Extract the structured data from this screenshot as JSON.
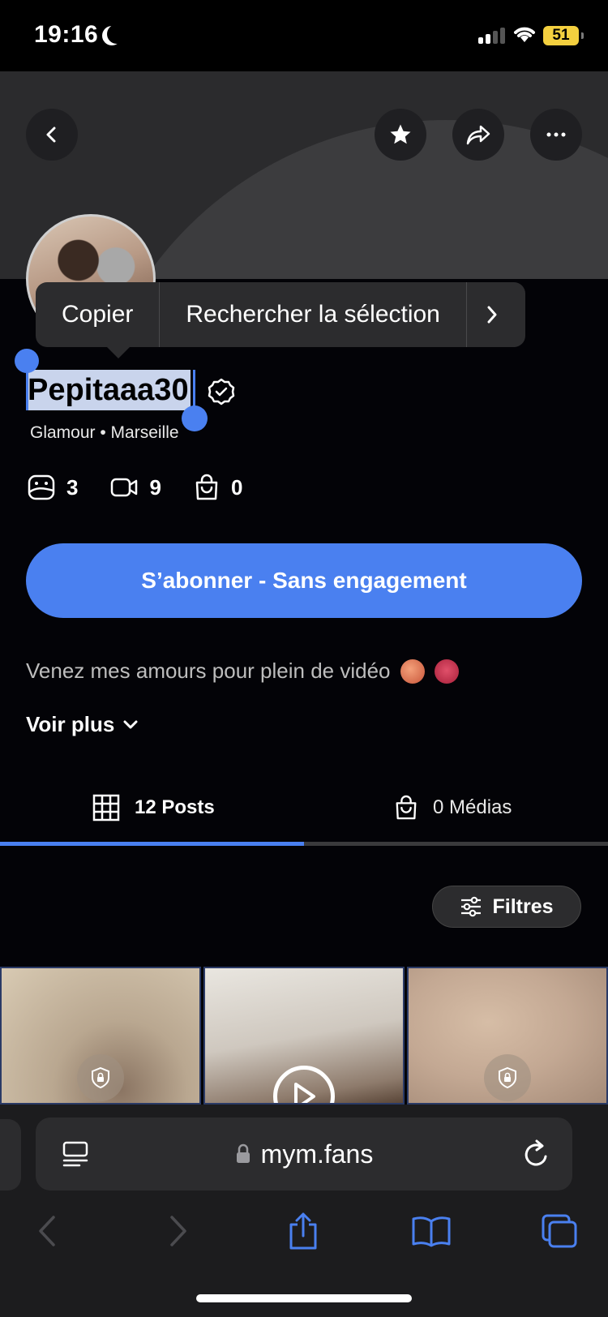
{
  "status": {
    "time": "19:16",
    "battery": "51"
  },
  "profile": {
    "username": "Pepitaaa30",
    "subtitle": "Glamour • Marseille",
    "stats": [
      {
        "icon": "photo-icon",
        "count": "3"
      },
      {
        "icon": "video-icon",
        "count": "9"
      },
      {
        "icon": "shopping-bag-icon",
        "count": "0"
      }
    ],
    "subscribe_label": "S’abonner - Sans engagement",
    "bio": "Venez mes amours pour plein de vidéo",
    "see_more": "Voir plus"
  },
  "context_menu": {
    "copy": "Copier",
    "search": "Rechercher la sélection"
  },
  "tabs": [
    {
      "label": "12 Posts",
      "active": true
    },
    {
      "label": "0 Médias",
      "active": false
    }
  ],
  "filters_label": "Filtres",
  "browser": {
    "url": "mym.fans"
  },
  "colors": {
    "accent": "#4a80f0",
    "background": "#030307"
  }
}
